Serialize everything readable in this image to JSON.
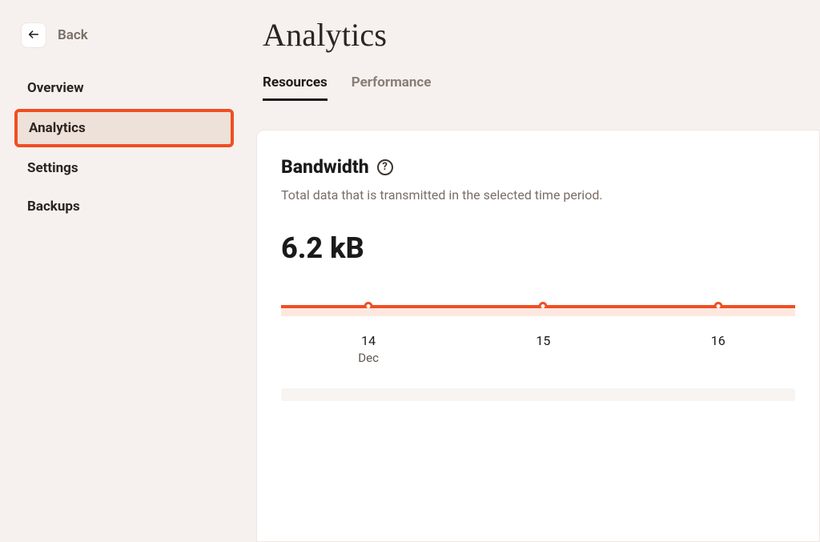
{
  "back_label": "Back",
  "sidebar": {
    "items": [
      {
        "label": "Overview",
        "active": false
      },
      {
        "label": "Analytics",
        "active": true
      },
      {
        "label": "Settings",
        "active": false
      },
      {
        "label": "Backups",
        "active": false
      }
    ]
  },
  "page": {
    "title": "Analytics"
  },
  "tabs": [
    {
      "label": "Resources",
      "active": true
    },
    {
      "label": "Performance",
      "active": false
    }
  ],
  "card": {
    "title": "Bandwidth",
    "subtitle": "Total data that is transmitted in the selected time period.",
    "metric": "6.2 kB"
  },
  "chart_data": {
    "type": "line",
    "title": "Bandwidth",
    "xlabel": "Dec",
    "ylabel": "",
    "categories": [
      "14",
      "15",
      "16"
    ],
    "month": "Dec",
    "values": [
      0,
      0,
      0
    ],
    "point_positions_pct": [
      17,
      51,
      85
    ]
  },
  "colors": {
    "accent": "#f04e23",
    "muted_text": "#7a6e67",
    "card_bg": "#ffffff",
    "page_bg": "#f6f1ee"
  }
}
